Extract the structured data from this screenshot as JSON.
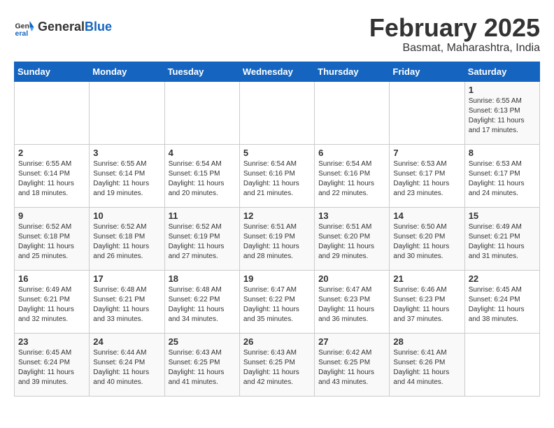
{
  "header": {
    "logo_general": "General",
    "logo_blue": "Blue",
    "title": "February 2025",
    "subtitle": "Basmat, Maharashtra, India"
  },
  "calendar": {
    "weekdays": [
      "Sunday",
      "Monday",
      "Tuesday",
      "Wednesday",
      "Thursday",
      "Friday",
      "Saturday"
    ],
    "weeks": [
      [
        {
          "day": "",
          "info": ""
        },
        {
          "day": "",
          "info": ""
        },
        {
          "day": "",
          "info": ""
        },
        {
          "day": "",
          "info": ""
        },
        {
          "day": "",
          "info": ""
        },
        {
          "day": "",
          "info": ""
        },
        {
          "day": "1",
          "info": "Sunrise: 6:55 AM\nSunset: 6:13 PM\nDaylight: 11 hours\nand 17 minutes."
        }
      ],
      [
        {
          "day": "2",
          "info": "Sunrise: 6:55 AM\nSunset: 6:14 PM\nDaylight: 11 hours\nand 18 minutes."
        },
        {
          "day": "3",
          "info": "Sunrise: 6:55 AM\nSunset: 6:14 PM\nDaylight: 11 hours\nand 19 minutes."
        },
        {
          "day": "4",
          "info": "Sunrise: 6:54 AM\nSunset: 6:15 PM\nDaylight: 11 hours\nand 20 minutes."
        },
        {
          "day": "5",
          "info": "Sunrise: 6:54 AM\nSunset: 6:16 PM\nDaylight: 11 hours\nand 21 minutes."
        },
        {
          "day": "6",
          "info": "Sunrise: 6:54 AM\nSunset: 6:16 PM\nDaylight: 11 hours\nand 22 minutes."
        },
        {
          "day": "7",
          "info": "Sunrise: 6:53 AM\nSunset: 6:17 PM\nDaylight: 11 hours\nand 23 minutes."
        },
        {
          "day": "8",
          "info": "Sunrise: 6:53 AM\nSunset: 6:17 PM\nDaylight: 11 hours\nand 24 minutes."
        }
      ],
      [
        {
          "day": "9",
          "info": "Sunrise: 6:52 AM\nSunset: 6:18 PM\nDaylight: 11 hours\nand 25 minutes."
        },
        {
          "day": "10",
          "info": "Sunrise: 6:52 AM\nSunset: 6:18 PM\nDaylight: 11 hours\nand 26 minutes."
        },
        {
          "day": "11",
          "info": "Sunrise: 6:52 AM\nSunset: 6:19 PM\nDaylight: 11 hours\nand 27 minutes."
        },
        {
          "day": "12",
          "info": "Sunrise: 6:51 AM\nSunset: 6:19 PM\nDaylight: 11 hours\nand 28 minutes."
        },
        {
          "day": "13",
          "info": "Sunrise: 6:51 AM\nSunset: 6:20 PM\nDaylight: 11 hours\nand 29 minutes."
        },
        {
          "day": "14",
          "info": "Sunrise: 6:50 AM\nSunset: 6:20 PM\nDaylight: 11 hours\nand 30 minutes."
        },
        {
          "day": "15",
          "info": "Sunrise: 6:49 AM\nSunset: 6:21 PM\nDaylight: 11 hours\nand 31 minutes."
        }
      ],
      [
        {
          "day": "16",
          "info": "Sunrise: 6:49 AM\nSunset: 6:21 PM\nDaylight: 11 hours\nand 32 minutes."
        },
        {
          "day": "17",
          "info": "Sunrise: 6:48 AM\nSunset: 6:21 PM\nDaylight: 11 hours\nand 33 minutes."
        },
        {
          "day": "18",
          "info": "Sunrise: 6:48 AM\nSunset: 6:22 PM\nDaylight: 11 hours\nand 34 minutes."
        },
        {
          "day": "19",
          "info": "Sunrise: 6:47 AM\nSunset: 6:22 PM\nDaylight: 11 hours\nand 35 minutes."
        },
        {
          "day": "20",
          "info": "Sunrise: 6:47 AM\nSunset: 6:23 PM\nDaylight: 11 hours\nand 36 minutes."
        },
        {
          "day": "21",
          "info": "Sunrise: 6:46 AM\nSunset: 6:23 PM\nDaylight: 11 hours\nand 37 minutes."
        },
        {
          "day": "22",
          "info": "Sunrise: 6:45 AM\nSunset: 6:24 PM\nDaylight: 11 hours\nand 38 minutes."
        }
      ],
      [
        {
          "day": "23",
          "info": "Sunrise: 6:45 AM\nSunset: 6:24 PM\nDaylight: 11 hours\nand 39 minutes."
        },
        {
          "day": "24",
          "info": "Sunrise: 6:44 AM\nSunset: 6:24 PM\nDaylight: 11 hours\nand 40 minutes."
        },
        {
          "day": "25",
          "info": "Sunrise: 6:43 AM\nSunset: 6:25 PM\nDaylight: 11 hours\nand 41 minutes."
        },
        {
          "day": "26",
          "info": "Sunrise: 6:43 AM\nSunset: 6:25 PM\nDaylight: 11 hours\nand 42 minutes."
        },
        {
          "day": "27",
          "info": "Sunrise: 6:42 AM\nSunset: 6:25 PM\nDaylight: 11 hours\nand 43 minutes."
        },
        {
          "day": "28",
          "info": "Sunrise: 6:41 AM\nSunset: 6:26 PM\nDaylight: 11 hours\nand 44 minutes."
        },
        {
          "day": "",
          "info": ""
        }
      ]
    ]
  }
}
